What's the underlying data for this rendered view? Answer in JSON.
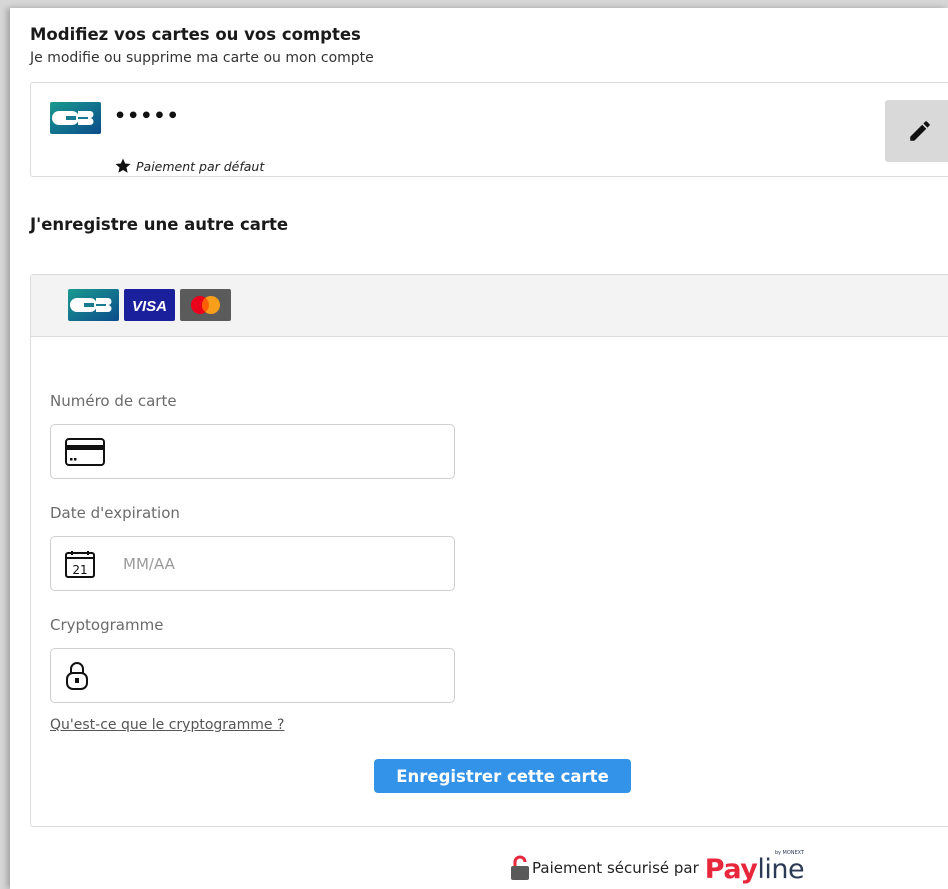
{
  "header": {
    "title": "Modifiez vos cartes ou vos comptes",
    "subtitle": "Je modifie ou supprime ma carte ou mon compte"
  },
  "saved_card": {
    "brand": "CB",
    "masked_number": "•••••",
    "default_label": "Paiement par défaut"
  },
  "new_card": {
    "title": "J'enregistre une autre carte",
    "brands": [
      "CB",
      "VISA",
      "mastercard"
    ],
    "card_number_label": "Numéro de carte",
    "card_number_value": "",
    "expiry_label": "Date d'expiration",
    "expiry_placeholder": "MM/AA",
    "expiry_value": "",
    "expiry_icon_day": "21",
    "cvv_label": "Cryptogramme",
    "cvv_value": "",
    "cvv_help_link": "Qu'est-ce que le cryptogramme ?",
    "submit_label": "Enregistrer cette carte"
  },
  "footer": {
    "secure_text": "Paiement sécurisé par",
    "brand_pay": "Pay",
    "brand_line": "line",
    "brand_byline": "by MONEXT"
  },
  "colors": {
    "accent_button": "#3393e8",
    "cb_green": "#0e8a8a",
    "visa_blue": "#1a1f9c",
    "payline_red": "#e8263c",
    "edit_button_bg": "#d9d9d9"
  },
  "icons": {
    "edit": "pencil-icon",
    "default_star": "star-icon",
    "card_field": "credit-card-icon",
    "expiry_field": "calendar-icon",
    "cvv_field": "padlock-icon",
    "footer_lock": "lock-icon"
  }
}
